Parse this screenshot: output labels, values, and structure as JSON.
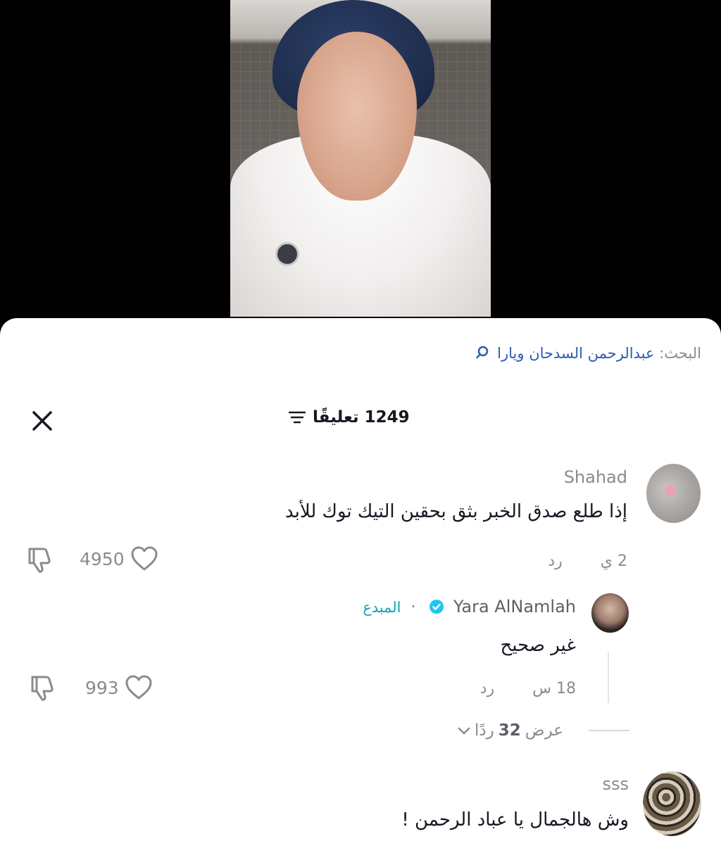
{
  "search": {
    "label": "البحث:",
    "query": "عبدالرحمن السدحان ويارا"
  },
  "header": {
    "count_label": "1249 تعليقًا"
  },
  "comments": [
    {
      "username": "Shahad",
      "text": "إذا طلع صدق الخبر بثق بحقين التيك توك للأبد",
      "time": "2 ي",
      "reply_label": "رد",
      "likes": "4950"
    },
    {
      "username": "Yara AlNamlah",
      "badge": "المبدع",
      "separator": "·",
      "text": "غير صحيح",
      "time": "18 س",
      "reply_label": "رد",
      "likes": "993"
    },
    {
      "username": "sss",
      "text": "وش هالجمال يا عباد الرحمن !"
    }
  ],
  "view_replies": {
    "prefix": "عرض",
    "count": "32",
    "suffix": "ردًا"
  },
  "icons": {
    "close": "close-icon",
    "filter": "filter-icon",
    "search": "search-icon",
    "heart": "heart-icon",
    "dislike": "dislike-icon",
    "verified": "verified-icon",
    "chevron": "chevron-down-icon"
  },
  "colors": {
    "link": "#2b5db3",
    "creator": "#14a3b8",
    "verified": "#20c5f0",
    "muted": "#8a8b91"
  }
}
